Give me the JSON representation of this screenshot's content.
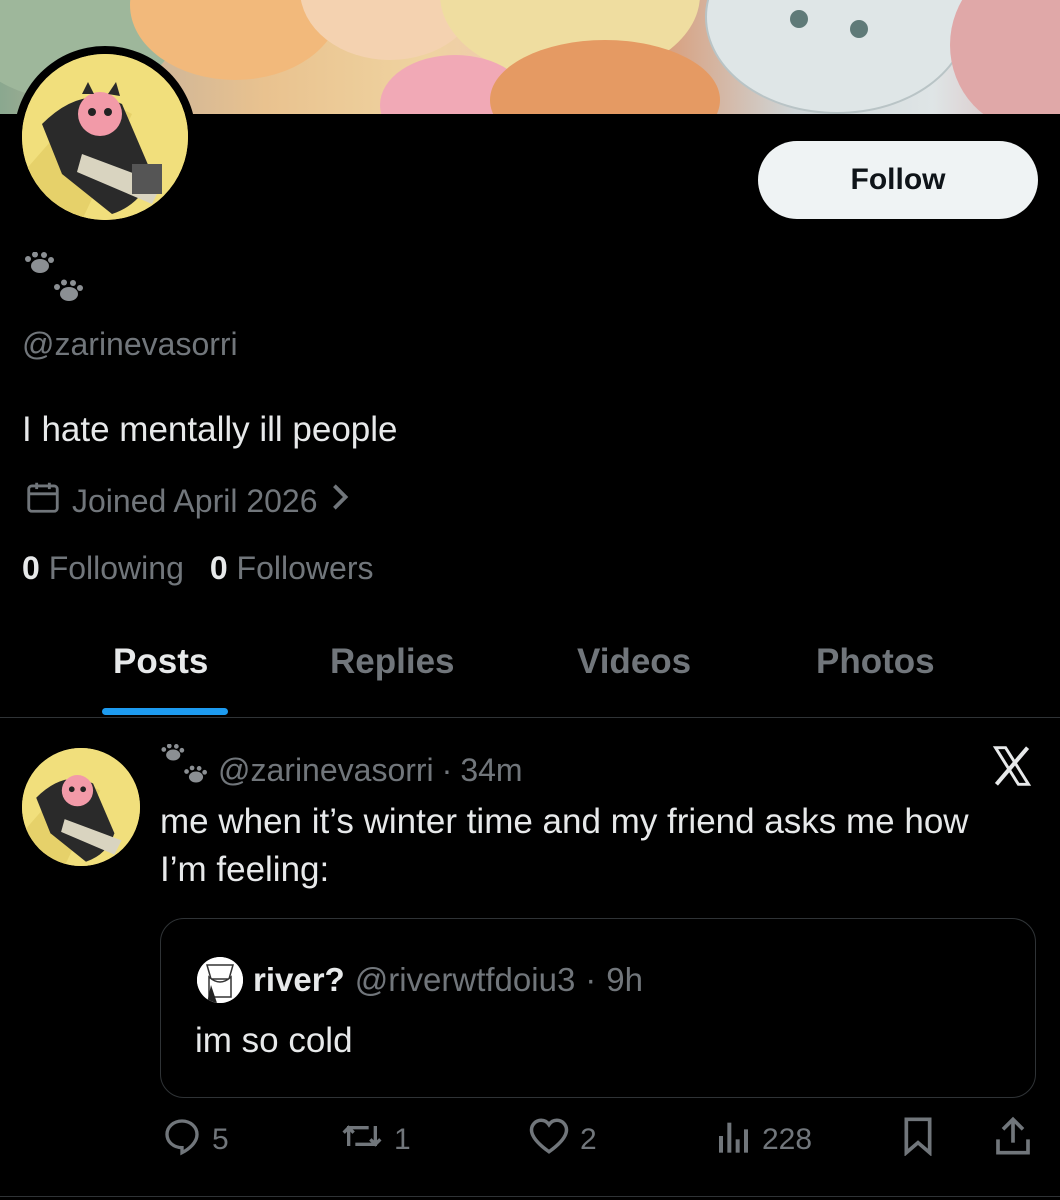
{
  "profile": {
    "handle": "@zarinevasorri",
    "bio": "I hate mentally ill people",
    "joined": "Joined April 2026",
    "following_count": "0",
    "following_label": "Following",
    "followers_count": "0",
    "followers_label": "Followers",
    "follow_label": "Follow"
  },
  "tabs": [
    {
      "label": "Posts",
      "active": true
    },
    {
      "label": "Replies",
      "active": false
    },
    {
      "label": "Videos",
      "active": false
    },
    {
      "label": "Photos",
      "active": false
    }
  ],
  "post": {
    "handle": "@zarinevasorri",
    "separator": "·",
    "time": "34m",
    "text": "me when it’s winter time and my friend asks me how I’m feeling:",
    "quote": {
      "name": "river?",
      "handle": "@riverwtfdoiu3",
      "separator": "·",
      "time": "9h",
      "text": "im so cold"
    },
    "actions": {
      "replies": "5",
      "reposts": "1",
      "likes": "2",
      "views": "228"
    }
  },
  "icons": {
    "paw": "paw-prints-icon",
    "calendar": "calendar-icon",
    "chevron": "chevron-right-icon",
    "x_logo": "x-logo-icon",
    "reply": "reply-icon",
    "repost": "repost-icon",
    "like": "heart-icon",
    "views": "views-icon",
    "bookmark": "bookmark-icon",
    "share": "share-icon"
  },
  "colors": {
    "background": "#000000",
    "text_primary": "#e7e9ea",
    "text_secondary": "#71767b",
    "accent": "#1d9bf0",
    "follow_button_bg": "#eff3f4"
  }
}
